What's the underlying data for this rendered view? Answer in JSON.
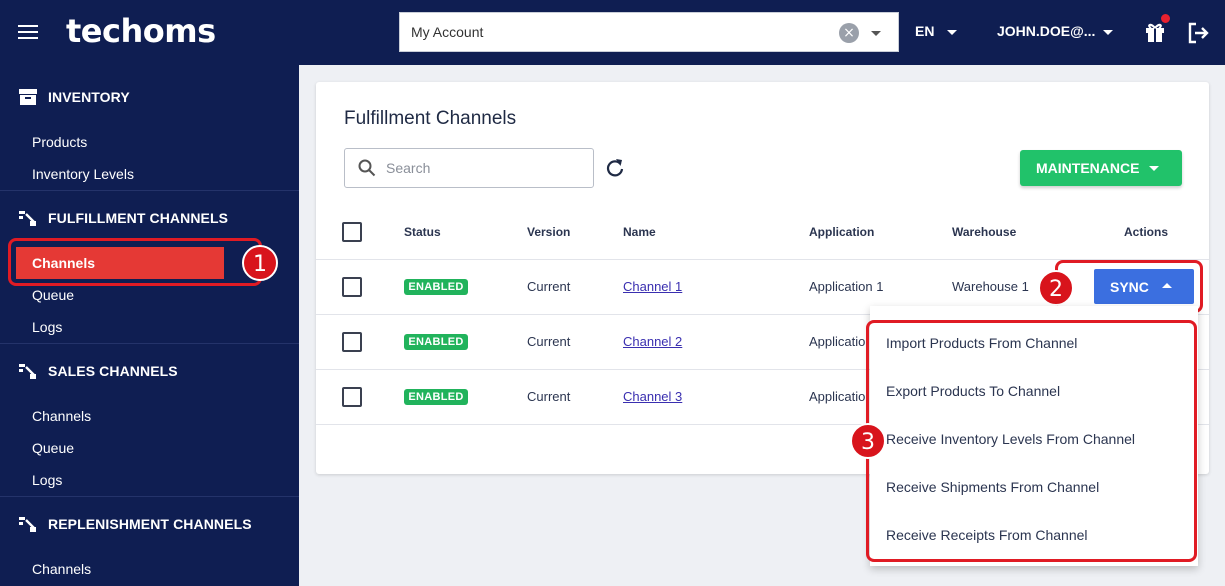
{
  "header": {
    "logo": "techoms",
    "account_value": "My Account",
    "language": "EN",
    "user": "JOHN.DOE@..."
  },
  "sidebar": {
    "sections": [
      {
        "title": "INVENTORY",
        "items": [
          "Products",
          "Inventory Levels"
        ]
      },
      {
        "title": "FULFILLMENT CHANNELS",
        "items": [
          "Channels",
          "Queue",
          "Logs"
        ]
      },
      {
        "title": "SALES CHANNELS",
        "items": [
          "Channels",
          "Queue",
          "Logs"
        ]
      },
      {
        "title": "REPLENISHMENT CHANNELS",
        "items": [
          "Channels"
        ]
      }
    ],
    "active_item": "Channels"
  },
  "main": {
    "title": "Fulfillment Channels",
    "search_placeholder": "Search",
    "maintenance_label": "MAINTENANCE",
    "columns": [
      "Status",
      "Version",
      "Name",
      "Application",
      "Warehouse",
      "Actions"
    ],
    "rows": [
      {
        "status": "ENABLED",
        "version": "Current",
        "name": "Channel 1",
        "application": "Application 1",
        "warehouse": "Warehouse 1"
      },
      {
        "status": "ENABLED",
        "version": "Current",
        "name": "Channel 2",
        "application": "Applicatio",
        "warehouse": ""
      },
      {
        "status": "ENABLED",
        "version": "Current",
        "name": "Channel 3",
        "application": "Applicatio",
        "warehouse": ""
      }
    ],
    "sync_label": "SYNC",
    "sync_menu": [
      "Import Products From Channel",
      "Export Products To Channel",
      "Receive Inventory Levels From Channel",
      "Receive Shipments From Channel",
      "Receive Receipts From Channel"
    ]
  },
  "callouts": [
    "1",
    "2",
    "3"
  ],
  "colors": {
    "nav_bg": "#0f1e52",
    "active": "#e53935",
    "maintenance": "#21c26a",
    "sync": "#3b6fe0",
    "enabled": "#21b35c",
    "callout": "#e01b24"
  }
}
